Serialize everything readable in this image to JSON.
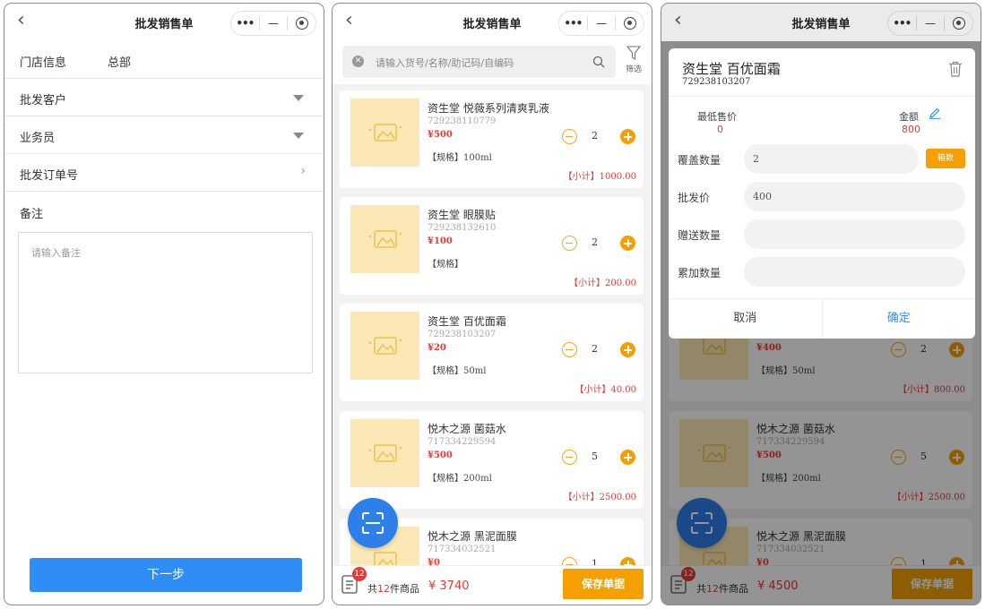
{
  "colors": {
    "accent_blue": "#2f8ef5",
    "accent_orange": "#f5a000",
    "price_red": "#e53935",
    "thumb_bg": "#fbe8b6"
  },
  "navbar": {
    "title": "批发销售单",
    "back_icon": "chevron-left-icon",
    "capsule_icons": [
      "more-icon",
      "minimize-icon",
      "target-icon"
    ]
  },
  "screen1": {
    "store_label": "门店信息",
    "store_value": "总部",
    "customer_label": "批发客户",
    "salesman_label": "业务员",
    "order_no_label": "批发订单号",
    "memo_label": "备注",
    "memo_placeholder": "请输入备注",
    "next_button": "下一步"
  },
  "search": {
    "placeholder": "请输入货号/名称/助记码/自编码",
    "filter_label": "筛选"
  },
  "products": [
    {
      "name": "资生堂 悦薇系列清爽乳液",
      "code": "729238110779",
      "price": "¥500",
      "qty": "2",
      "spec": "【规格】100ml",
      "subtotal": "【小计】1000.00"
    },
    {
      "name": "资生堂 眼膜贴",
      "code": "729238132610",
      "price": "¥100",
      "qty": "2",
      "spec": "【规格】",
      "subtotal": "【小计】200.00"
    },
    {
      "name": "资生堂 百优面霜",
      "code": "729238103207",
      "price": "¥20",
      "qty": "2",
      "spec": "【规格】50ml",
      "subtotal": "【小计】40.00"
    },
    {
      "name": "悦木之源 菌菇水",
      "code": "717334229594",
      "price": "¥500",
      "qty": "5",
      "spec": "【规格】200ml",
      "subtotal": "【小计】2500.00"
    },
    {
      "name": "悦木之源 黑泥面膜",
      "code": "717334032521",
      "price": "¥0",
      "qty": "1",
      "spec": "",
      "subtotal": ""
    }
  ],
  "screen3_products": [
    {
      "price": "¥400",
      "qty": "2",
      "spec": "【规格】50ml",
      "subtotal": "【小计】800.00"
    },
    {
      "name": "悦木之源 菌菇水",
      "code": "717334229594",
      "price": "¥500",
      "qty": "5",
      "spec": "【规格】200ml",
      "subtotal": "【小计】2500.00"
    },
    {
      "name": "悦木之源 黑泥面膜",
      "code": "717334032521",
      "price": "¥0",
      "qty": "1"
    }
  ],
  "bottom2": {
    "badge": "12",
    "prefix": "共",
    "count": "12",
    "suffix": "件商品",
    "total": "¥ 3740",
    "save": "保存单据"
  },
  "bottom3": {
    "badge": "12",
    "prefix": "共",
    "count": "12",
    "suffix": "件商品",
    "total": "¥ 4500",
    "save": "保存单据"
  },
  "modal": {
    "title": "资生堂 百优面霜",
    "code": "729238103207",
    "min_price_label": "最低售价",
    "min_price_value": "0",
    "amount_label": "金额",
    "amount_value": "800",
    "cover_qty_label": "覆盖数量",
    "cover_qty_value": "2",
    "box_button": "箱数",
    "wholesale_price_label": "批发价",
    "wholesale_price_value": "400",
    "gift_qty_label": "赠送数量",
    "add_qty_label": "累加数量",
    "cancel": "取消",
    "confirm": "确定"
  }
}
